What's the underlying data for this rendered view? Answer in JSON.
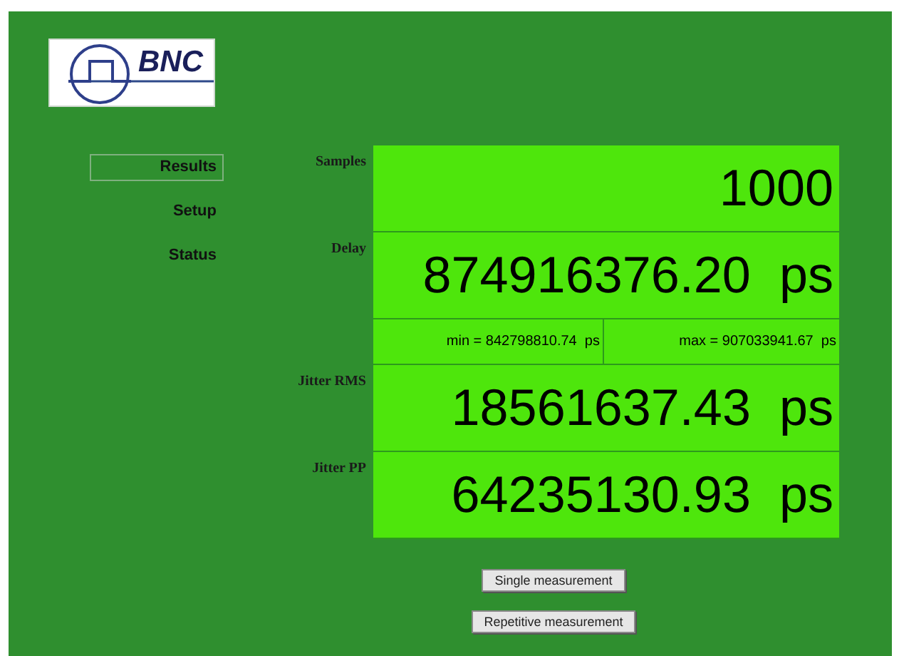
{
  "logo": {
    "text": "BNC"
  },
  "nav": [
    {
      "label": "Results",
      "selected": true
    },
    {
      "label": "Setup",
      "selected": false
    },
    {
      "label": "Status",
      "selected": false
    }
  ],
  "readings": [
    {
      "kind": "value",
      "label": "Samples",
      "value": "1000"
    },
    {
      "kind": "value",
      "label": "Delay",
      "value": "874916376.20",
      "unit": "ps"
    },
    {
      "kind": "range",
      "min": "min = 842798810.74  ps",
      "max": "max = 907033941.67  ps"
    },
    {
      "kind": "value",
      "label": "Jitter RMS",
      "value": "18561637.43",
      "unit": "ps"
    },
    {
      "kind": "value",
      "label": "Jitter PP",
      "value": "64235130.93",
      "unit": "ps"
    }
  ],
  "buttons": [
    "Single measurement",
    "Repetitive measurement"
  ]
}
